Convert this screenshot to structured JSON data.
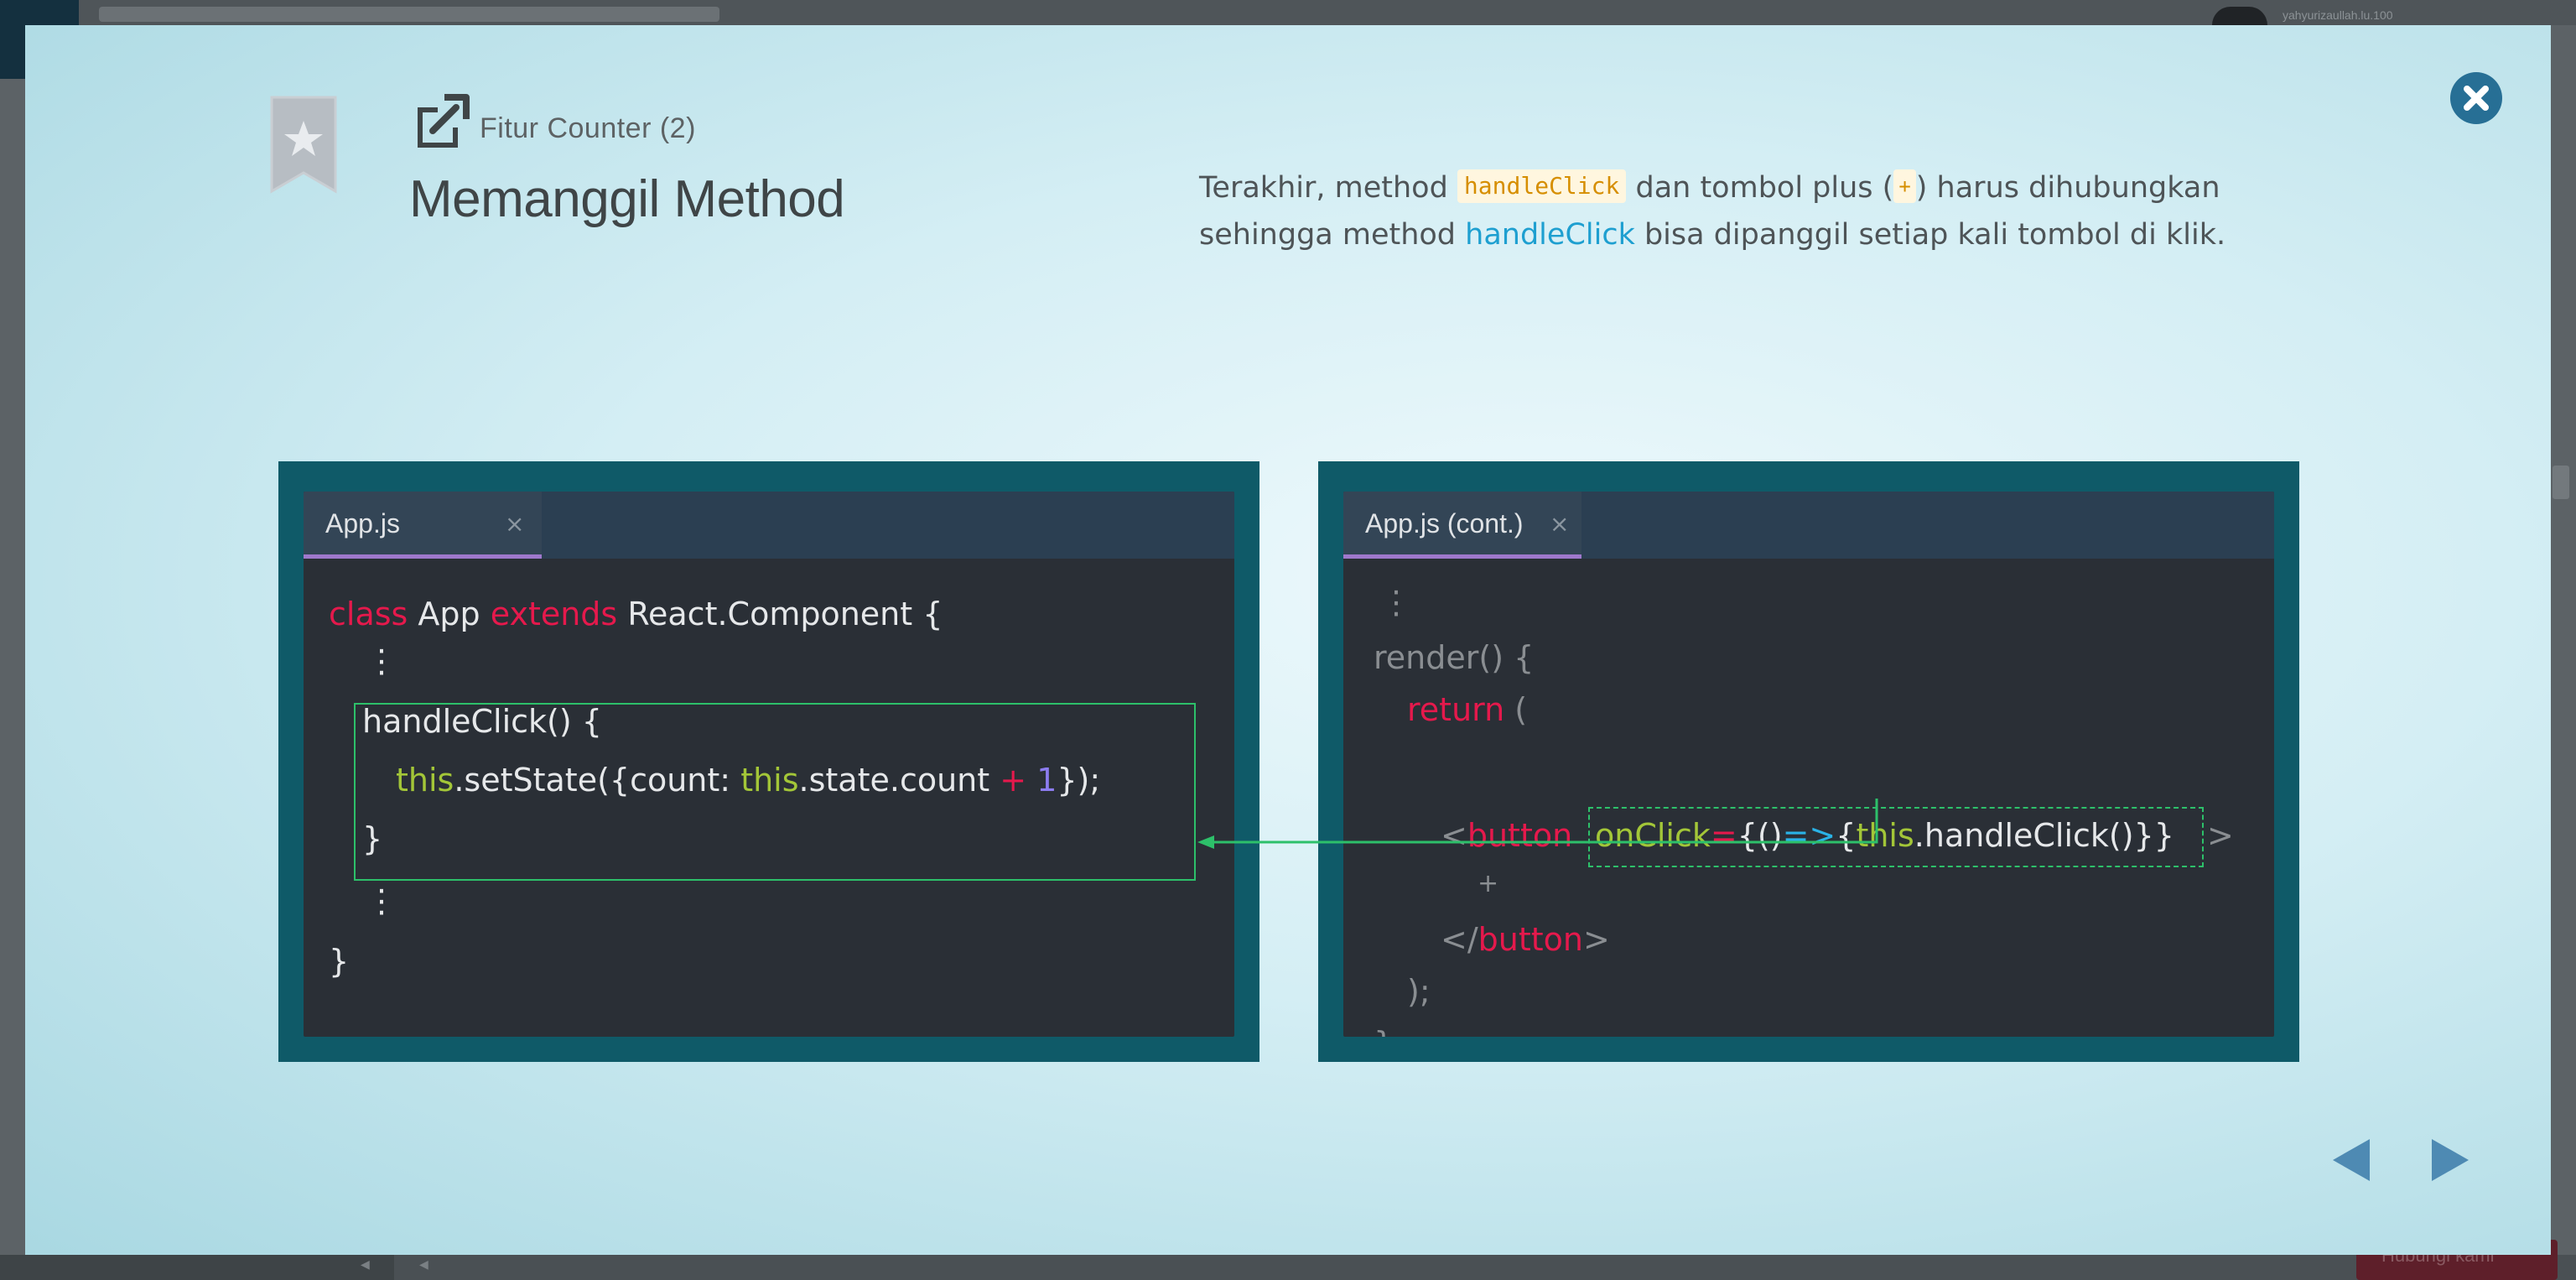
{
  "background": {
    "username": "yahyurizaullah.lu.100",
    "bottom_button_label": "Hubungi kami"
  },
  "lesson": {
    "label": "Fitur Counter (2)",
    "title": "Memanggil Method"
  },
  "description": {
    "part1": "Terakhir, method ",
    "chip1": "handleClick",
    "part2": " dan tombol plus (",
    "chip2": "+",
    "part3": ") harus dihubungkan sehingga method ",
    "highlight": "handleClick",
    "part4": " bisa dipanggil setiap kali tombol di klik."
  },
  "left_editor": {
    "tab_label": "App.js",
    "tab_close": "×",
    "lines": {
      "l1_kw1": "class",
      "l1_name": " App ",
      "l1_kw2": "extends",
      "l1_rest": " React.Component {",
      "l2": "⋮",
      "l3": "handleClick() {",
      "l4_this1": "this",
      "l4_a": ".setState({count: ",
      "l4_this2": "this",
      "l4_b": ".state.count ",
      "l4_plus": "+",
      "l4_space": " ",
      "l4_num": "1",
      "l4_c": "});",
      "l5": "}",
      "l6": "⋮",
      "l7": "}"
    }
  },
  "right_editor": {
    "tab_label": "App.js (cont.)",
    "tab_close": "×",
    "lines": {
      "l1": "⋮",
      "l2": "render() {",
      "l3_kw": "return",
      "l3_rest": " (",
      "l4_lt": "<",
      "l4_tag": "button",
      "l4_attr": "onClick",
      "l4_eq": "=",
      "l4_b1": "{",
      "l4_paren": "()",
      "l4_arrow": "=>",
      "l4_b2": "{",
      "l4_this": "this",
      "l4_call": ".handleClick()",
      "l4_b3": "}}",
      "l4_gt": ">",
      "l5": "+",
      "l6_lt": "</",
      "l6_tag": "button",
      "l6_gt": ">",
      "l7": ");",
      "l8": "}"
    }
  },
  "colors": {
    "keyword": "#e5194c",
    "this": "#a3c638",
    "highlight_box": "#2dc06a",
    "tab_underline": "#9f78cc",
    "panel_frame": "#0f5a68"
  }
}
